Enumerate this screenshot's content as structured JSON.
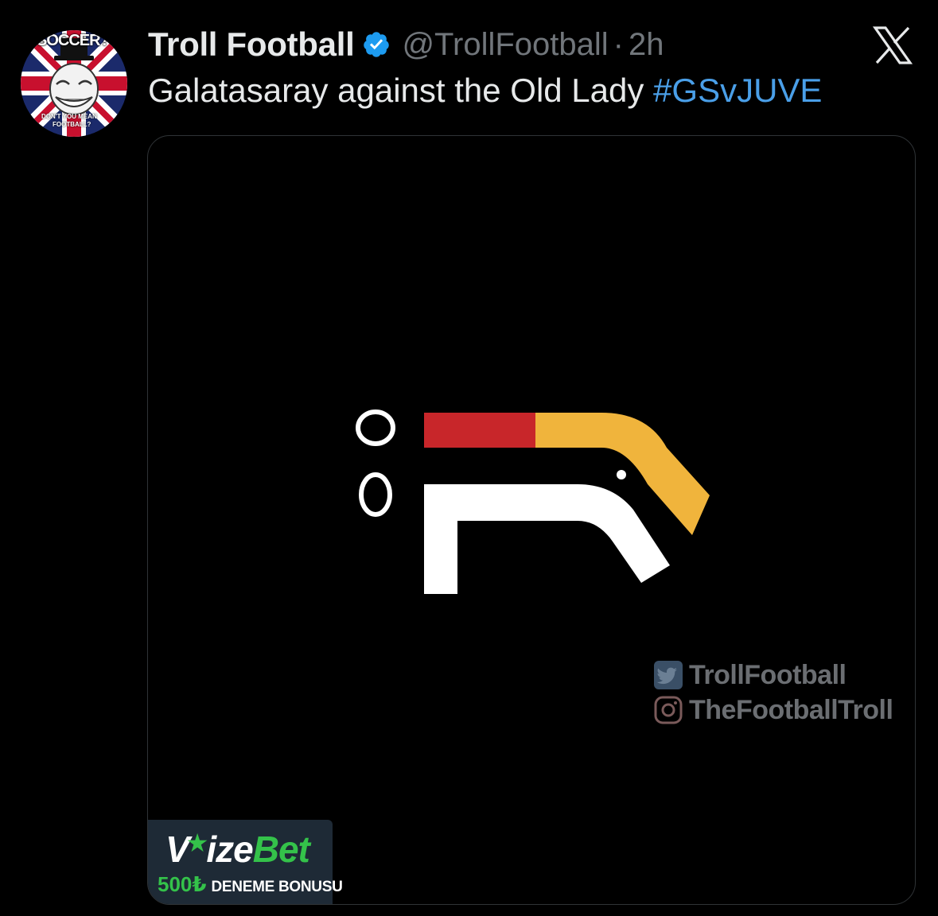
{
  "tweet": {
    "author": {
      "display_name": "Troll Football",
      "handle": "@TrollFootball",
      "verified_icon": "verified-badge-icon",
      "avatar": {
        "top_text": "SOCCER?",
        "bottom_text_1": "DON'T YOU MEAN",
        "bottom_text_2": "FOOTBALL?"
      }
    },
    "separator": "·",
    "time": "2h",
    "text_main": "Galatasaray against the Old Lady ",
    "hashtag": "#GSvJUVE",
    "platform_icon": "x-logo-icon"
  },
  "media": {
    "watermark": {
      "twitter_label": "TrollFootball",
      "instagram_label": "TheFootballTroll"
    },
    "ad": {
      "brand_first": "V",
      "brand_mid": "ize",
      "brand_last": "Bet",
      "amount": "500₺",
      "offer": "DENEME BONUSU"
    }
  },
  "colors": {
    "background": "#000000",
    "text_primary": "#e7e9ea",
    "text_secondary": "#71767b",
    "link": "#4a9fe8",
    "logo_red": "#c8262a",
    "logo_yellow": "#f0b43c",
    "logo_white": "#ffffff",
    "ad_green": "#34c24a"
  }
}
